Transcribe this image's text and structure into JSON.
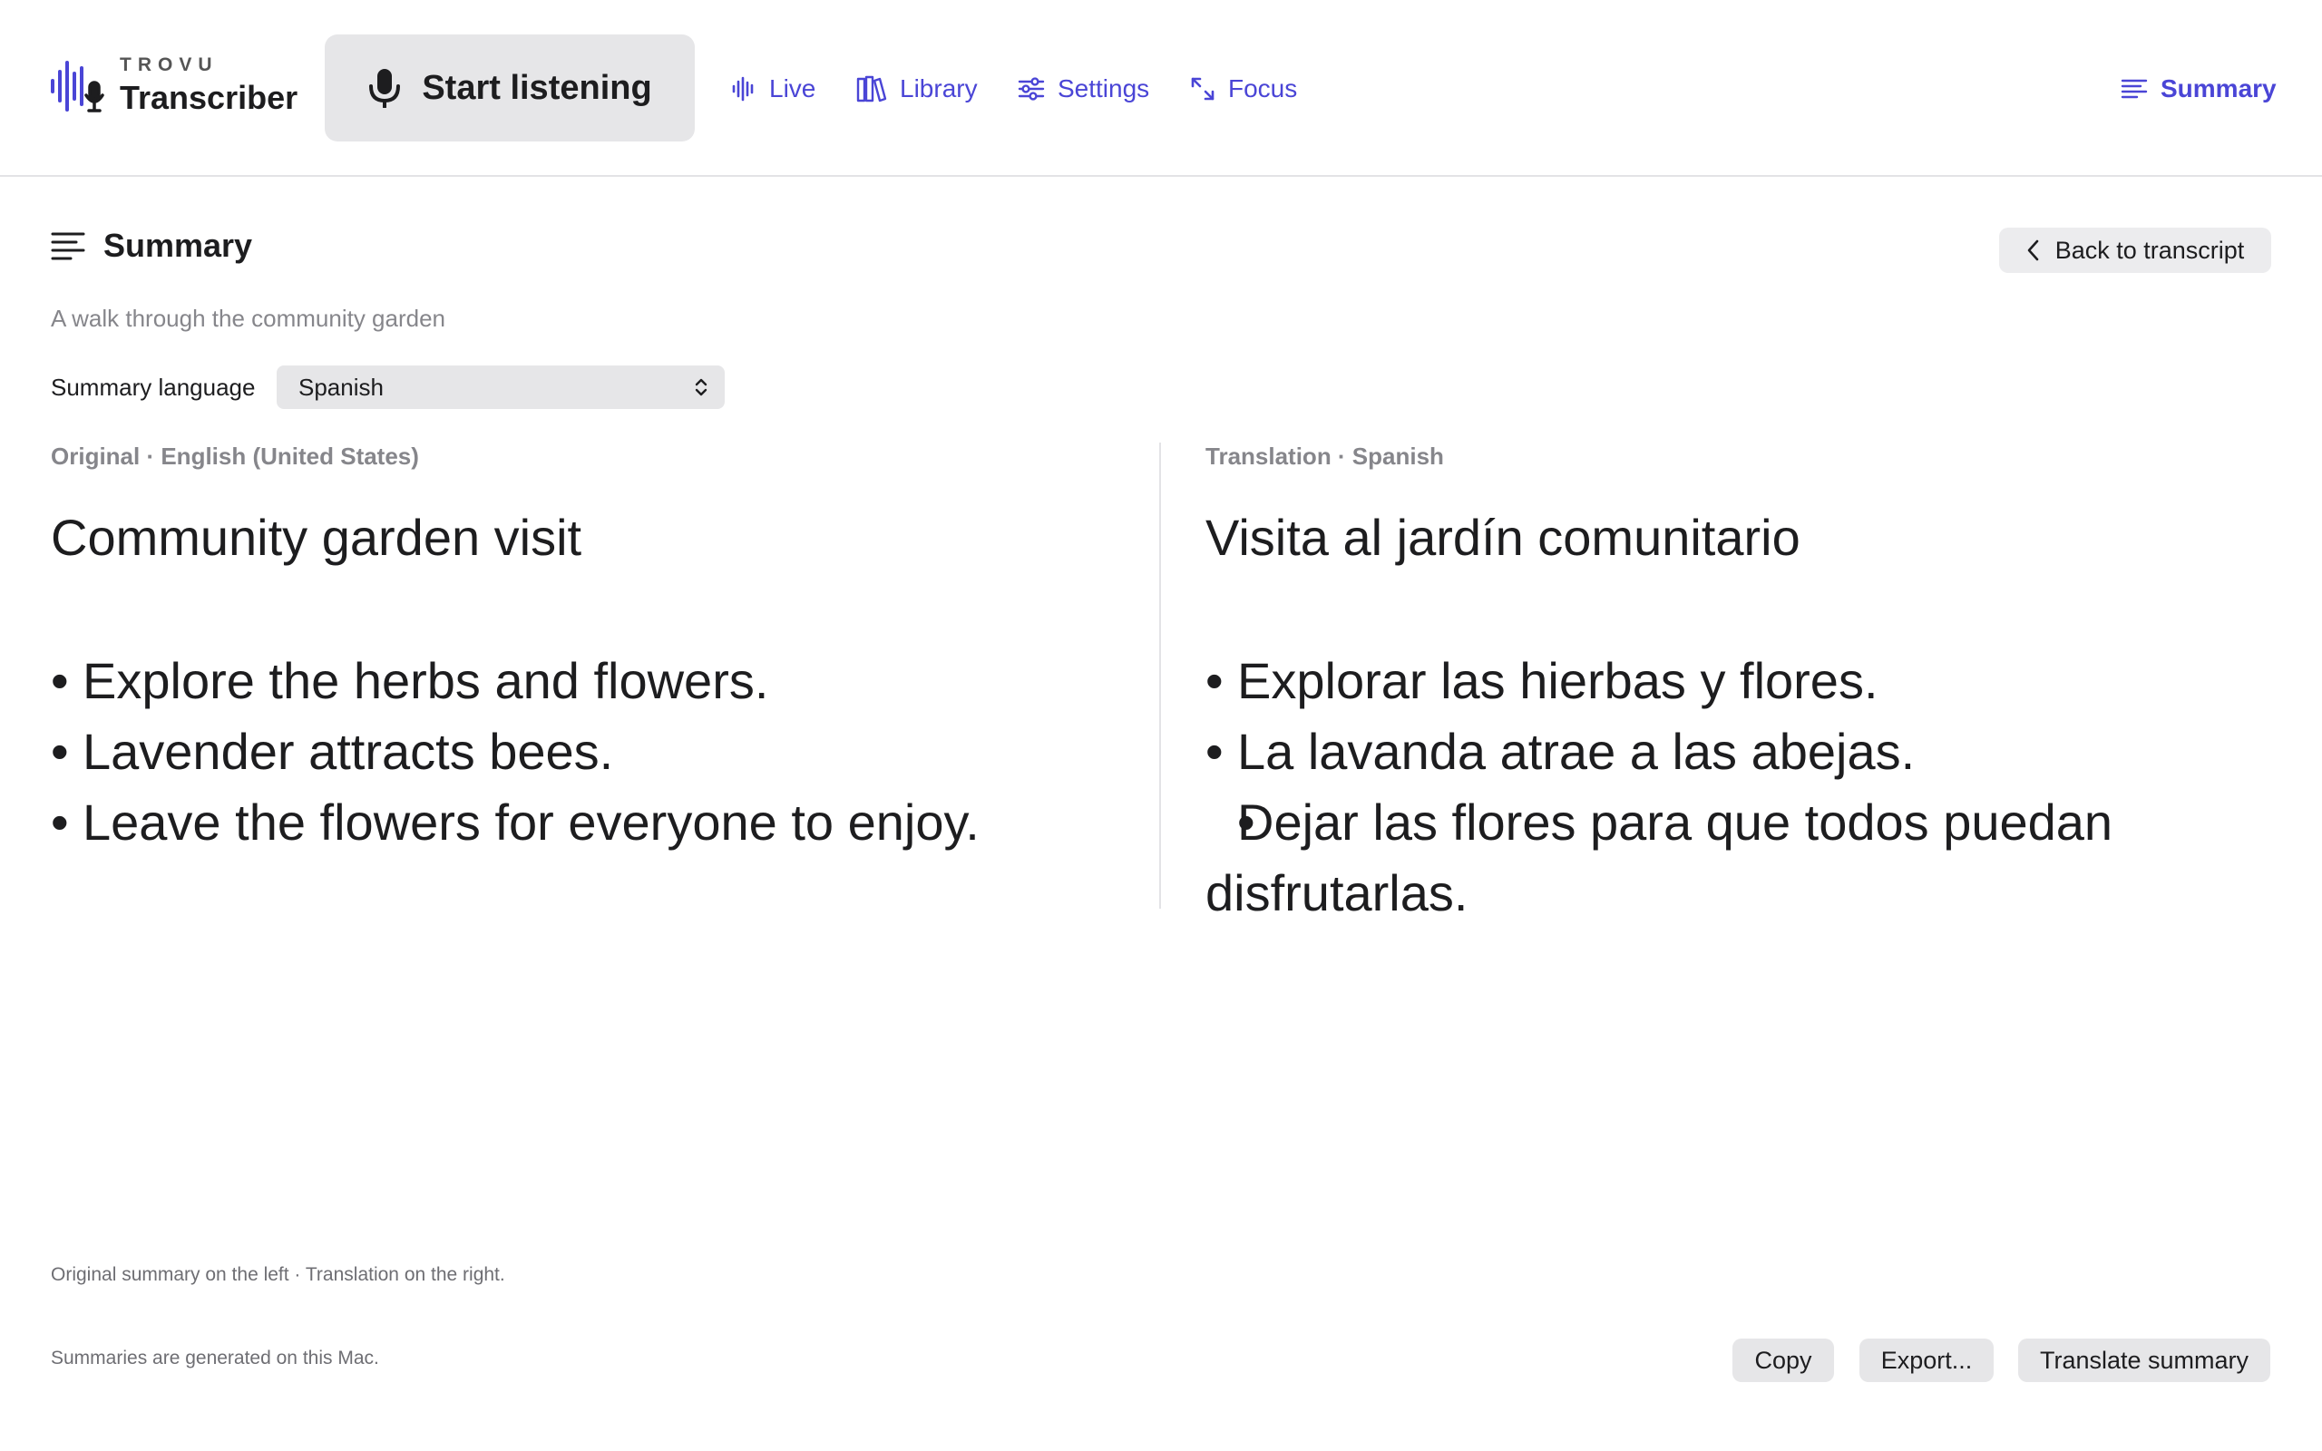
{
  "brand": {
    "super": "TROVU",
    "name": "Transcriber"
  },
  "toolbar": {
    "listen_label": "Start listening",
    "nav": {
      "live": "Live",
      "library": "Library",
      "settings": "Settings",
      "focus": "Focus",
      "summary": "Summary"
    }
  },
  "summary": {
    "title": "Summary",
    "back_label": "Back to transcript",
    "subtitle": "A walk through the community garden",
    "language_label": "Summary language",
    "language_value": "Spanish"
  },
  "original": {
    "label": "Original · English (United States)",
    "heading": "Community garden visit",
    "bullets": [
      "Explore the herbs and flowers.",
      "Lavender attracts bees.",
      "Leave the flowers for everyone to enjoy."
    ]
  },
  "translation": {
    "label": "Translation · Spanish",
    "heading": "Visita al jardín comunitario",
    "bullets": [
      "Explorar las hierbas y flores.",
      "La lavanda atrae a las abejas.",
      "Dejar las flores para que todos puedan disfrutarlas."
    ]
  },
  "footer": {
    "note": "Original summary on the left · Translation on the right.",
    "privacy": "Summaries are generated on this Mac.",
    "copy_label": "Copy",
    "export_label": "Export...",
    "translate_label": "Translate summary"
  },
  "colors": {
    "accent": "#4a45d6",
    "text": "#1d1d1f",
    "muted": "#86868b",
    "button_bg": "#e6e6e8"
  },
  "icons": [
    "waveform-mic-logo",
    "mic-icon",
    "waveform-icon",
    "library-icon",
    "sliders-icon",
    "expand-icon",
    "lines-icon",
    "chevron-left-icon",
    "updown-chevron-icon"
  ]
}
